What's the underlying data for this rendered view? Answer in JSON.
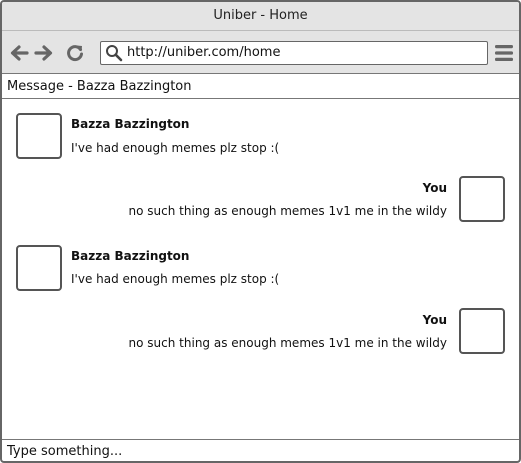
{
  "window": {
    "title": "Uniber - Home"
  },
  "toolbar": {
    "back_icon": "arrow-left-icon",
    "forward_icon": "arrow-right-icon",
    "reload_icon": "reload-icon",
    "url": "http://uniber.com/home",
    "menu_icon": "hamburger-menu-icon"
  },
  "conversation": {
    "header": "Message - Bazza Bazzington",
    "messages": [
      {
        "sender": "Bazza Bazzington",
        "text": "I've had enough memes plz stop :("
      },
      {
        "sender": "You",
        "text": "no such thing as enough memes 1v1 me in the wildy"
      },
      {
        "sender": "Bazza Bazzington",
        "text": "I've had enough memes plz stop :("
      },
      {
        "sender": "You",
        "text": "no such thing as enough memes 1v1 me in the wildy"
      }
    ]
  },
  "composer": {
    "placeholder": "Type something..."
  }
}
